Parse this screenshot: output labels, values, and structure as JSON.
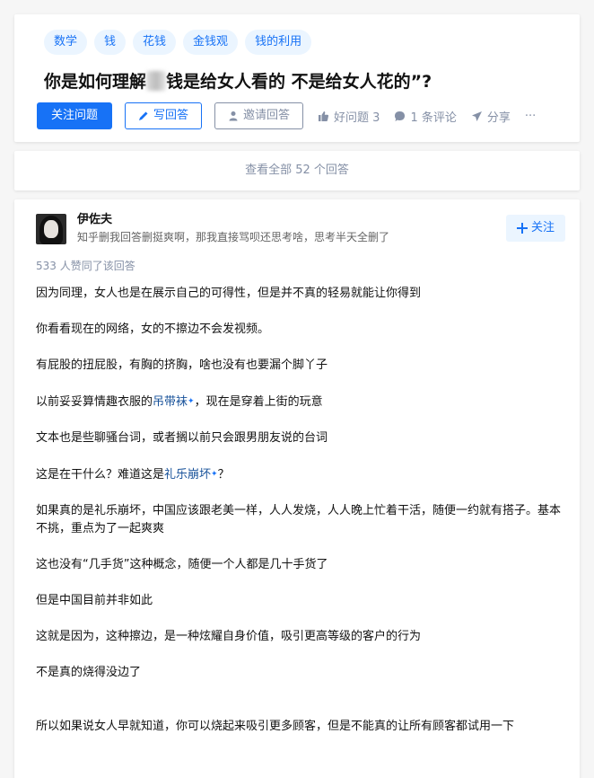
{
  "question": {
    "topics": [
      "数学",
      "钱",
      "花钱",
      "金钱观",
      "钱的利用"
    ],
    "title_pre": "你是如何理解",
    "title_post": "钱是给女人看的 不是给女人花的”?",
    "follow_label": "关注问题",
    "write_label": "写回答",
    "invite_label": "邀请回答",
    "good_label": "好问题 3",
    "comments_label": "1 条评论",
    "share_label": "分享",
    "more_label": "···"
  },
  "view_all": "查看全部 52 个回答",
  "answer": {
    "author_name": "伊佐夫",
    "author_bio": "知乎删我回答删挺爽啊，那我直接骂呗还思考啥，思考半天全删了",
    "follow_label": "关注",
    "upvotes": "533 人赞同了该回答",
    "paragraphs": [
      {
        "text": "因为同理，女人也是在展示自己的可得性，但是并不真的轻易就能让你得到"
      },
      {
        "text": "你看看现在的网络，女的不擦边不会发视频。"
      },
      {
        "text": "有屁股的扭屁股，有胸的挤胸，啥也没有也要漏个脚丫子"
      },
      {
        "pre": "以前妥妥算情趣衣服的",
        "link": "吊带袜",
        "post": "，现在是穿着上街的玩意"
      },
      {
        "text": "文本也是些聊骚台词，或者搁以前只会跟男朋友说的台词"
      },
      {
        "pre": "这是在干什么？难道这是",
        "link": "礼乐崩坏",
        "post": "？"
      },
      {
        "text": "如果真的是礼乐崩坏，中国应该跟老美一样，人人发烧，人人晚上忙着干活，随便一约就有搭子。基本不挑，重点为了一起爽爽"
      },
      {
        "text": "这也没有“几手货”这种概念，随便一个人都是几十手货了"
      },
      {
        "text": "但是中国目前并非如此"
      },
      {
        "text": "这就是因为，这种擦边，是一种炫耀自身价值，吸引更高等级的客户的行为"
      },
      {
        "text": "不是真的烧得没边了"
      },
      {
        "text": "所以如果说女人早就知道，你可以烧起来吸引更多顾客，但是不能真的让所有顾客都试用一下"
      }
    ]
  },
  "colors": {
    "accent": "#1772f6",
    "muted": "#8590a6",
    "link": "#175199",
    "tag_bg": "#ebf5ff"
  }
}
